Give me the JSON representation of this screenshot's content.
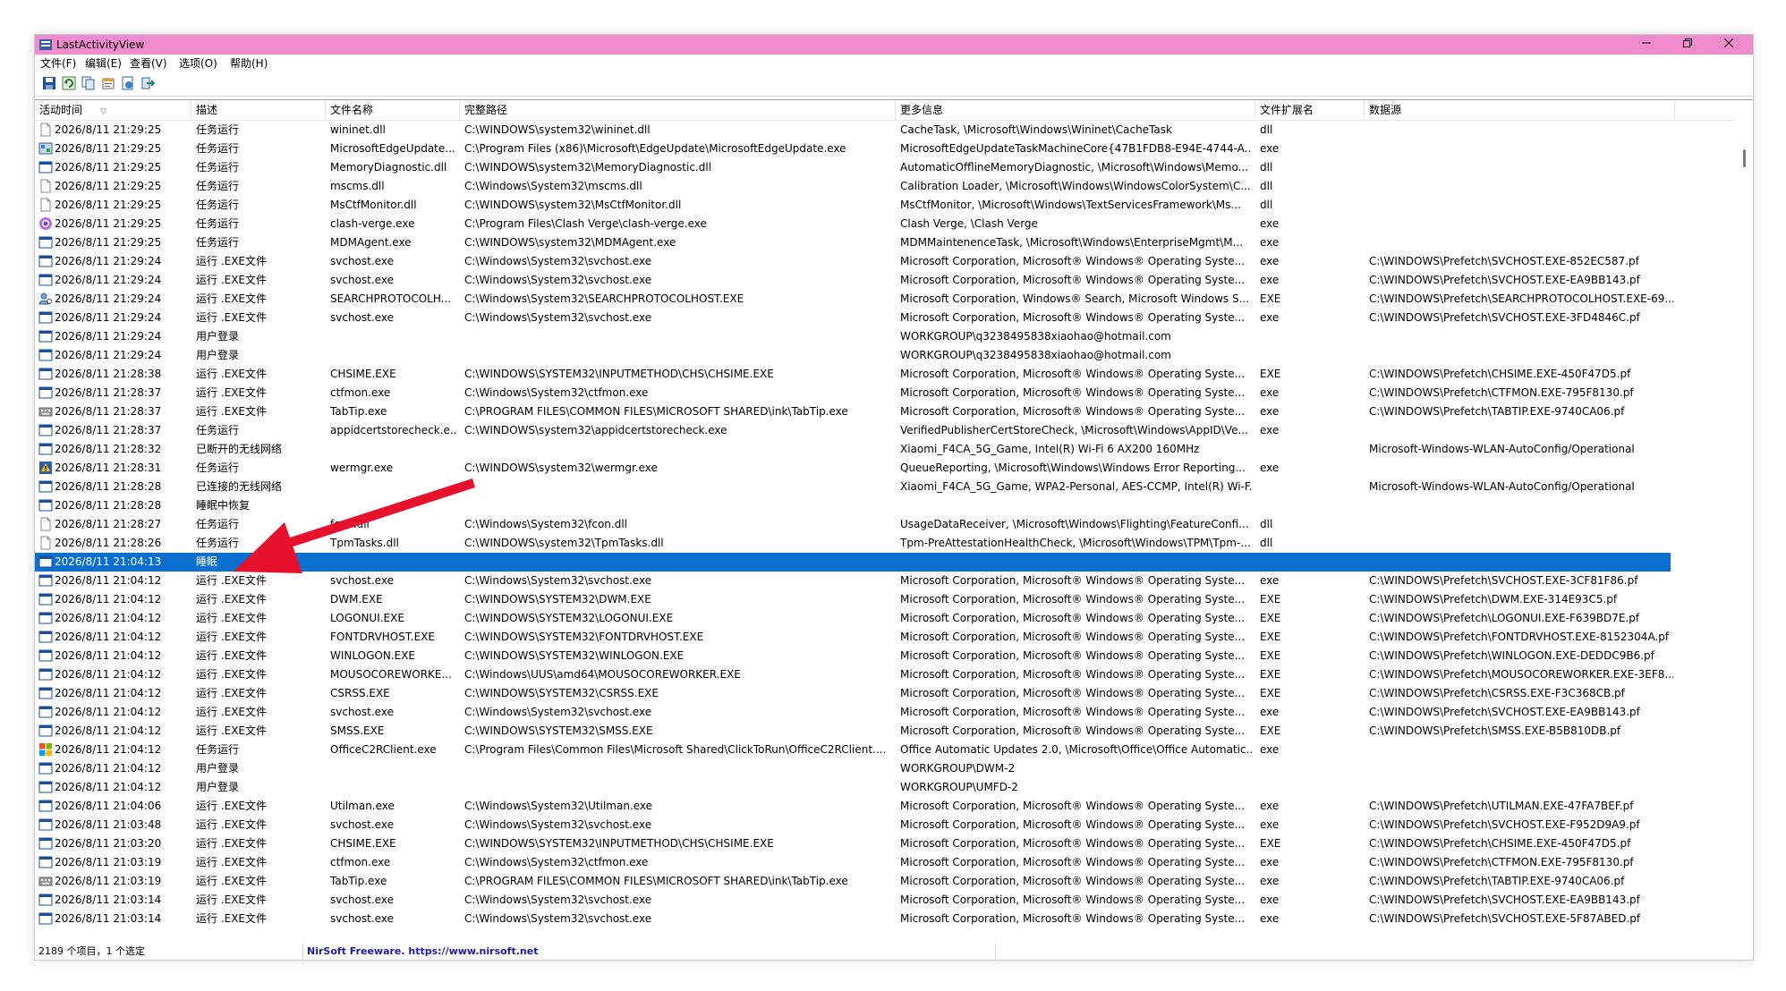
{
  "app": {
    "title": "LastActivityView"
  },
  "menu": [
    "文件(F)",
    "编辑(E)",
    "查看(V)",
    "选项(O)",
    "帮助(H)"
  ],
  "toolbar": [
    "save-icon",
    "refresh-icon",
    "copy-icon",
    "properties-icon",
    "html-report-icon",
    "exit-icon"
  ],
  "columns": [
    "活动时间",
    "描述",
    "文件名称",
    "完整路径",
    "更多信息",
    "文件扩展名",
    "数据源"
  ],
  "sort_indicator": "▽",
  "colors": {
    "titlebar": "#f08ccd",
    "selected_row": "#0a6fcf",
    "annotation_arrow": "#e8112d",
    "status_link": "#1a1aa8"
  },
  "rows": [
    {
      "icon": "file-icon",
      "time": "2026/8/11 21:29:25",
      "desc": "任务运行",
      "name": "wininet.dll",
      "path": "C:\\WINDOWS\\system32\\wininet.dll",
      "info": "CacheTask, \\Microsoft\\Windows\\Wininet\\CacheTask",
      "ext": "dll",
      "source": ""
    },
    {
      "icon": "edge-update-icon",
      "time": "2026/8/11 21:29:25",
      "desc": "任务运行",
      "name": "MicrosoftEdgeUpdate...",
      "path": "C:\\Program Files (x86)\\Microsoft\\EdgeUpdate\\MicrosoftEdgeUpdate.exe",
      "info": "MicrosoftEdgeUpdateTaskMachineCore{47B1FDB8-E94E-4744-A...",
      "ext": "exe",
      "source": ""
    },
    {
      "icon": "exe-icon",
      "time": "2026/8/11 21:29:25",
      "desc": "任务运行",
      "name": "MemoryDiagnostic.dll",
      "path": "C:\\WINDOWS\\system32\\MemoryDiagnostic.dll",
      "info": "AutomaticOfflineMemoryDiagnostic, \\Microsoft\\Windows\\Memo...",
      "ext": "dll",
      "source": ""
    },
    {
      "icon": "file-icon",
      "time": "2026/8/11 21:29:25",
      "desc": "任务运行",
      "name": "mscms.dll",
      "path": "C:\\Windows\\System32\\mscms.dll",
      "info": "Calibration Loader, \\Microsoft\\Windows\\WindowsColorSystem\\C...",
      "ext": "dll",
      "source": ""
    },
    {
      "icon": "file-icon",
      "time": "2026/8/11 21:29:25",
      "desc": "任务运行",
      "name": "MsCtfMonitor.dll",
      "path": "C:\\WINDOWS\\system32\\MsCtfMonitor.dll",
      "info": "MsCtfMonitor, \\Microsoft\\Windows\\TextServicesFramework\\Ms...",
      "ext": "dll",
      "source": ""
    },
    {
      "icon": "clash-verge-icon",
      "time": "2026/8/11 21:29:25",
      "desc": "任务运行",
      "name": "clash-verge.exe",
      "path": "C:\\Program Files\\Clash Verge\\clash-verge.exe",
      "info": "Clash Verge, \\Clash Verge",
      "ext": "exe",
      "source": ""
    },
    {
      "icon": "exe-icon",
      "time": "2026/8/11 21:29:25",
      "desc": "任务运行",
      "name": "MDMAgent.exe",
      "path": "C:\\WINDOWS\\system32\\MDMAgent.exe",
      "info": "MDMMaintenenceTask, \\Microsoft\\Windows\\EnterpriseMgmt\\M...",
      "ext": "exe",
      "source": ""
    },
    {
      "icon": "exe-icon",
      "time": "2026/8/11 21:29:24",
      "desc": "运行 .EXE文件",
      "name": "svchost.exe",
      "path": "C:\\Windows\\System32\\svchost.exe",
      "info": "Microsoft Corporation, Microsoft® Windows® Operating Syste...",
      "ext": "exe",
      "source": "C:\\WINDOWS\\Prefetch\\SVCHOST.EXE-852EC587.pf"
    },
    {
      "icon": "exe-icon",
      "time": "2026/8/11 21:29:24",
      "desc": "运行 .EXE文件",
      "name": "svchost.exe",
      "path": "C:\\Windows\\System32\\svchost.exe",
      "info": "Microsoft Corporation, Microsoft® Windows® Operating Syste...",
      "ext": "exe",
      "source": "C:\\WINDOWS\\Prefetch\\SVCHOST.EXE-EA9BB143.pf"
    },
    {
      "icon": "search-protocol-icon",
      "time": "2026/8/11 21:29:24",
      "desc": "运行 .EXE文件",
      "name": "SEARCHPROTOCOLH...",
      "path": "C:\\Windows\\System32\\SEARCHPROTOCOLHOST.EXE",
      "info": "Microsoft Corporation, Windows® Search, Microsoft Windows S...",
      "ext": "EXE",
      "source": "C:\\WINDOWS\\Prefetch\\SEARCHPROTOCOLHOST.EXE-69..."
    },
    {
      "icon": "exe-icon",
      "time": "2026/8/11 21:29:24",
      "desc": "运行 .EXE文件",
      "name": "svchost.exe",
      "path": "C:\\Windows\\System32\\svchost.exe",
      "info": "Microsoft Corporation, Microsoft® Windows® Operating Syste...",
      "ext": "exe",
      "source": "C:\\WINDOWS\\Prefetch\\SVCHOST.EXE-3FD4846C.pf"
    },
    {
      "icon": "exe-icon",
      "time": "2026/8/11 21:29:24",
      "desc": "用户登录",
      "name": "",
      "path": "",
      "info": "WORKGROUP\\q3238495838xiaohao@hotmail.com",
      "ext": "",
      "source": ""
    },
    {
      "icon": "exe-icon",
      "time": "2026/8/11 21:29:24",
      "desc": "用户登录",
      "name": "",
      "path": "",
      "info": "WORKGROUP\\q3238495838xiaohao@hotmail.com",
      "ext": "",
      "source": ""
    },
    {
      "icon": "exe-icon",
      "time": "2026/8/11 21:28:38",
      "desc": "运行 .EXE文件",
      "name": "CHSIME.EXE",
      "path": "C:\\WINDOWS\\SYSTEM32\\INPUTMETHOD\\CHS\\CHSIME.EXE",
      "info": "Microsoft Corporation, Microsoft® Windows® Operating Syste...",
      "ext": "EXE",
      "source": "C:\\WINDOWS\\Prefetch\\CHSIME.EXE-450F47D5.pf"
    },
    {
      "icon": "exe-icon",
      "time": "2026/8/11 21:28:37",
      "desc": "运行 .EXE文件",
      "name": "ctfmon.exe",
      "path": "C:\\Windows\\System32\\ctfmon.exe",
      "info": "Microsoft Corporation, Microsoft® Windows® Operating Syste...",
      "ext": "exe",
      "source": "C:\\WINDOWS\\Prefetch\\CTFMON.EXE-795F8130.pf"
    },
    {
      "icon": "keyboard-icon",
      "time": "2026/8/11 21:28:37",
      "desc": "运行 .EXE文件",
      "name": "TabTip.exe",
      "path": "C:\\PROGRAM FILES\\COMMON FILES\\MICROSOFT SHARED\\ink\\TabTip.exe",
      "info": "Microsoft Corporation, Microsoft® Windows® Operating Syste...",
      "ext": "exe",
      "source": "C:\\WINDOWS\\Prefetch\\TABTIP.EXE-9740CA06.pf"
    },
    {
      "icon": "exe-icon",
      "time": "2026/8/11 21:28:37",
      "desc": "任务运行",
      "name": "appidcertstorecheck.e...",
      "path": "C:\\WINDOWS\\system32\\appidcertstorecheck.exe",
      "info": "VerifiedPublisherCertStoreCheck, \\Microsoft\\Windows\\AppID\\Ve...",
      "ext": "exe",
      "source": ""
    },
    {
      "icon": "exe-icon",
      "time": "2026/8/11 21:28:32",
      "desc": "已断开的无线网络",
      "name": "",
      "path": "",
      "info": "Xiaomi_F4CA_5G_Game, Intel(R) Wi-Fi 6 AX200 160MHz",
      "ext": "",
      "source": "Microsoft-Windows-WLAN-AutoConfig/Operational"
    },
    {
      "icon": "error-report-icon",
      "time": "2026/8/11 21:28:31",
      "desc": "任务运行",
      "name": "wermgr.exe",
      "path": "C:\\WINDOWS\\system32\\wermgr.exe",
      "info": "QueueReporting, \\Microsoft\\Windows\\Windows Error Reporting...",
      "ext": "exe",
      "source": ""
    },
    {
      "icon": "exe-icon",
      "time": "2026/8/11 21:28:28",
      "desc": "已连接的无线网络",
      "name": "",
      "path": "",
      "info": "Xiaomi_F4CA_5G_Game, WPA2-Personal, AES-CCMP, Intel(R) Wi-F...",
      "ext": "",
      "source": "Microsoft-Windows-WLAN-AutoConfig/Operational"
    },
    {
      "icon": "exe-icon",
      "time": "2026/8/11 21:28:28",
      "desc": "睡眠中恢复",
      "name": "",
      "path": "",
      "info": "",
      "ext": "",
      "source": ""
    },
    {
      "icon": "file-icon",
      "time": "2026/8/11 21:28:27",
      "desc": "任务运行",
      "name": "fcon.dll",
      "path": "C:\\Windows\\System32\\fcon.dll",
      "info": "UsageDataReceiver, \\Microsoft\\Windows\\Flighting\\FeatureConfi...",
      "ext": "dll",
      "source": ""
    },
    {
      "icon": "file-icon",
      "time": "2026/8/11 21:28:26",
      "desc": "任务运行",
      "name": "TpmTasks.dll",
      "path": "C:\\WINDOWS\\system32\\TpmTasks.dll",
      "info": "Tpm-PreAttestationHealthCheck, \\Microsoft\\Windows\\TPM\\Tpm-...",
      "ext": "dll",
      "source": ""
    },
    {
      "icon": "exe-icon",
      "time": "2026/8/11 21:04:13",
      "desc": "睡眠",
      "name": "",
      "path": "",
      "info": "",
      "ext": "",
      "source": "",
      "selected": true
    },
    {
      "icon": "exe-icon",
      "time": "2026/8/11 21:04:12",
      "desc": "运行 .EXE文件",
      "name": "svchost.exe",
      "path": "C:\\Windows\\System32\\svchost.exe",
      "info": "Microsoft Corporation, Microsoft® Windows® Operating Syste...",
      "ext": "exe",
      "source": "C:\\WINDOWS\\Prefetch\\SVCHOST.EXE-3CF81F86.pf"
    },
    {
      "icon": "exe-icon",
      "time": "2026/8/11 21:04:12",
      "desc": "运行 .EXE文件",
      "name": "DWM.EXE",
      "path": "C:\\WINDOWS\\SYSTEM32\\DWM.EXE",
      "info": "Microsoft Corporation, Microsoft® Windows® Operating Syste...",
      "ext": "EXE",
      "source": "C:\\WINDOWS\\Prefetch\\DWM.EXE-314E93C5.pf"
    },
    {
      "icon": "exe-icon",
      "time": "2026/8/11 21:04:12",
      "desc": "运行 .EXE文件",
      "name": "LOGONUI.EXE",
      "path": "C:\\WINDOWS\\SYSTEM32\\LOGONUI.EXE",
      "info": "Microsoft Corporation, Microsoft® Windows® Operating Syste...",
      "ext": "EXE",
      "source": "C:\\WINDOWS\\Prefetch\\LOGONUI.EXE-F639BD7E.pf"
    },
    {
      "icon": "exe-icon",
      "time": "2026/8/11 21:04:12",
      "desc": "运行 .EXE文件",
      "name": "FONTDRVHOST.EXE",
      "path": "C:\\WINDOWS\\SYSTEM32\\FONTDRVHOST.EXE",
      "info": "Microsoft Corporation, Microsoft® Windows® Operating Syste...",
      "ext": "EXE",
      "source": "C:\\WINDOWS\\Prefetch\\FONTDRVHOST.EXE-8152304A.pf"
    },
    {
      "icon": "exe-icon",
      "time": "2026/8/11 21:04:12",
      "desc": "运行 .EXE文件",
      "name": "WINLOGON.EXE",
      "path": "C:\\WINDOWS\\SYSTEM32\\WINLOGON.EXE",
      "info": "Microsoft Corporation, Microsoft® Windows® Operating Syste...",
      "ext": "EXE",
      "source": "C:\\WINDOWS\\Prefetch\\WINLOGON.EXE-DEDDC9B6.pf"
    },
    {
      "icon": "exe-icon",
      "time": "2026/8/11 21:04:12",
      "desc": "运行 .EXE文件",
      "name": "MOUSOCOREWORKE...",
      "path": "C:\\Windows\\UUS\\amd64\\MOUSOCOREWORKER.EXE",
      "info": "Microsoft Corporation, Microsoft® Windows® Operating Syste...",
      "ext": "EXE",
      "source": "C:\\WINDOWS\\Prefetch\\MOUSOCOREWORKER.EXE-3EF8..."
    },
    {
      "icon": "exe-icon",
      "time": "2026/8/11 21:04:12",
      "desc": "运行 .EXE文件",
      "name": "CSRSS.EXE",
      "path": "C:\\WINDOWS\\SYSTEM32\\CSRSS.EXE",
      "info": "Microsoft Corporation, Microsoft® Windows® Operating Syste...",
      "ext": "EXE",
      "source": "C:\\WINDOWS\\Prefetch\\CSRSS.EXE-F3C368CB.pf"
    },
    {
      "icon": "exe-icon",
      "time": "2026/8/11 21:04:12",
      "desc": "运行 .EXE文件",
      "name": "svchost.exe",
      "path": "C:\\Windows\\System32\\svchost.exe",
      "info": "Microsoft Corporation, Microsoft® Windows® Operating Syste...",
      "ext": "exe",
      "source": "C:\\WINDOWS\\Prefetch\\SVCHOST.EXE-EA9BB143.pf"
    },
    {
      "icon": "exe-icon",
      "time": "2026/8/11 21:04:12",
      "desc": "运行 .EXE文件",
      "name": "SMSS.EXE",
      "path": "C:\\WINDOWS\\SYSTEM32\\SMSS.EXE",
      "info": "Microsoft Corporation, Microsoft® Windows® Operating Syste...",
      "ext": "EXE",
      "source": "C:\\WINDOWS\\Prefetch\\SMSS.EXE-B5B810DB.pf"
    },
    {
      "icon": "office-icon",
      "time": "2026/8/11 21:04:12",
      "desc": "任务运行",
      "name": "OfficeC2RClient.exe",
      "path": "C:\\Program Files\\Common Files\\Microsoft Shared\\ClickToRun\\OfficeC2RClient....",
      "info": "Office Automatic Updates 2.0, \\Microsoft\\Office\\Office Automatic...",
      "ext": "exe",
      "source": ""
    },
    {
      "icon": "exe-icon",
      "time": "2026/8/11 21:04:12",
      "desc": "用户登录",
      "name": "",
      "path": "",
      "info": "WORKGROUP\\DWM-2",
      "ext": "",
      "source": ""
    },
    {
      "icon": "exe-icon",
      "time": "2026/8/11 21:04:12",
      "desc": "用户登录",
      "name": "",
      "path": "",
      "info": "WORKGROUP\\UMFD-2",
      "ext": "",
      "source": ""
    },
    {
      "icon": "exe-icon",
      "time": "2026/8/11 21:04:06",
      "desc": "运行 .EXE文件",
      "name": "Utilman.exe",
      "path": "C:\\Windows\\System32\\Utilman.exe",
      "info": "Microsoft Corporation, Microsoft® Windows® Operating Syste...",
      "ext": "exe",
      "source": "C:\\WINDOWS\\Prefetch\\UTILMAN.EXE-47FA7BEF.pf"
    },
    {
      "icon": "exe-icon",
      "time": "2026/8/11 21:03:48",
      "desc": "运行 .EXE文件",
      "name": "svchost.exe",
      "path": "C:\\Windows\\System32\\svchost.exe",
      "info": "Microsoft Corporation, Microsoft® Windows® Operating Syste...",
      "ext": "exe",
      "source": "C:\\WINDOWS\\Prefetch\\SVCHOST.EXE-F952D9A9.pf"
    },
    {
      "icon": "exe-icon",
      "time": "2026/8/11 21:03:20",
      "desc": "运行 .EXE文件",
      "name": "CHSIME.EXE",
      "path": "C:\\WINDOWS\\SYSTEM32\\INPUTMETHOD\\CHS\\CHSIME.EXE",
      "info": "Microsoft Corporation, Microsoft® Windows® Operating Syste...",
      "ext": "EXE",
      "source": "C:\\WINDOWS\\Prefetch\\CHSIME.EXE-450F47D5.pf"
    },
    {
      "icon": "exe-icon",
      "time": "2026/8/11 21:03:19",
      "desc": "运行 .EXE文件",
      "name": "ctfmon.exe",
      "path": "C:\\Windows\\System32\\ctfmon.exe",
      "info": "Microsoft Corporation, Microsoft® Windows® Operating Syste...",
      "ext": "exe",
      "source": "C:\\WINDOWS\\Prefetch\\CTFMON.EXE-795F8130.pf"
    },
    {
      "icon": "keyboard-icon",
      "time": "2026/8/11 21:03:19",
      "desc": "运行 .EXE文件",
      "name": "TabTip.exe",
      "path": "C:\\PROGRAM FILES\\COMMON FILES\\MICROSOFT SHARED\\ink\\TabTip.exe",
      "info": "Microsoft Corporation, Microsoft® Windows® Operating Syste...",
      "ext": "exe",
      "source": "C:\\WINDOWS\\Prefetch\\TABTIP.EXE-9740CA06.pf"
    },
    {
      "icon": "exe-icon",
      "time": "2026/8/11 21:03:14",
      "desc": "运行 .EXE文件",
      "name": "svchost.exe",
      "path": "C:\\Windows\\System32\\svchost.exe",
      "info": "Microsoft Corporation, Microsoft® Windows® Operating Syste...",
      "ext": "exe",
      "source": "C:\\WINDOWS\\Prefetch\\SVCHOST.EXE-EA9BB143.pf"
    },
    {
      "icon": "exe-icon",
      "time": "2026/8/11 21:03:14",
      "desc": "运行 .EXE文件",
      "name": "svchost.exe",
      "path": "C:\\Windows\\System32\\svchost.exe",
      "info": "Microsoft Corporation, Microsoft® Windows® Operating Syste...",
      "ext": "exe",
      "source": "C:\\WINDOWS\\Prefetch\\SVCHOST.EXE-5F87ABED.pf"
    }
  ],
  "status": {
    "count": "2189 个项目，1 个选定",
    "link": "NirSoft Freeware. https://www.nirsoft.net"
  }
}
